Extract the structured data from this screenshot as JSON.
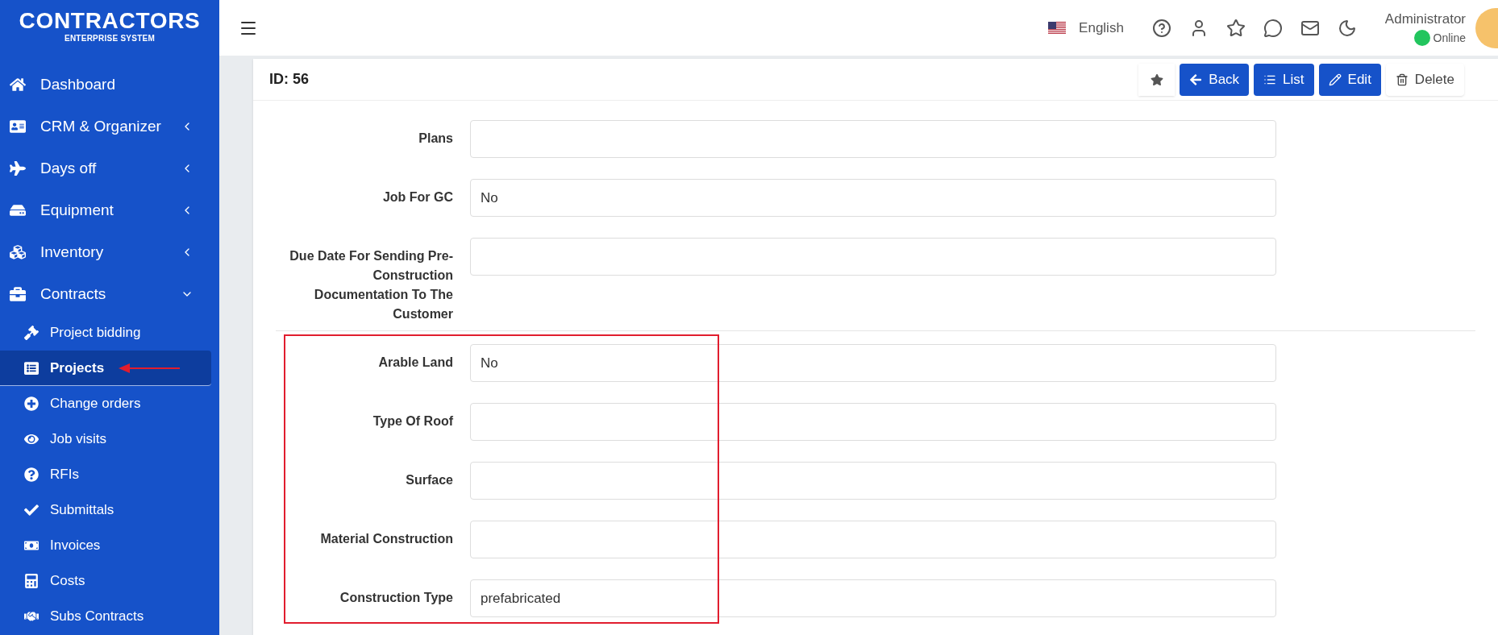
{
  "brand": {
    "name": "CONTRACTORS",
    "tagline": "ENTERPRISE SYSTEM"
  },
  "sidebar": {
    "items": [
      {
        "label": "Dashboard",
        "kind": "leaf"
      },
      {
        "label": "CRM & Organizer",
        "kind": "group",
        "expanded": false
      },
      {
        "label": "Days off",
        "kind": "group",
        "expanded": false
      },
      {
        "label": "Equipment",
        "kind": "group",
        "expanded": false
      },
      {
        "label": "Inventory",
        "kind": "group",
        "expanded": false
      },
      {
        "label": "Contracts",
        "kind": "group",
        "expanded": true,
        "children": [
          {
            "label": "Project bidding",
            "selected": false
          },
          {
            "label": "Projects",
            "selected": true
          },
          {
            "label": "Change orders",
            "selected": false
          },
          {
            "label": "Job visits",
            "selected": false
          },
          {
            "label": "RFIs",
            "selected": false
          },
          {
            "label": "Submittals",
            "selected": false
          },
          {
            "label": "Invoices",
            "selected": false
          },
          {
            "label": "Costs",
            "selected": false
          },
          {
            "label": "Subs Contracts",
            "selected": false
          }
        ]
      }
    ]
  },
  "header": {
    "language": "English",
    "user": {
      "name": "Administrator",
      "status": "Online",
      "color": "#22c55e"
    }
  },
  "record": {
    "title": "ID: 56",
    "buttons": [
      {
        "kind": "favorite"
      },
      {
        "kind": "primary",
        "label": "Back"
      },
      {
        "kind": "primary",
        "label": "List"
      },
      {
        "kind": "primary",
        "label": "Edit"
      },
      {
        "kind": "plain",
        "label": "Delete"
      }
    ],
    "sections": [
      {
        "highlighted": false,
        "fields": [
          {
            "label": "Plans"
          },
          {
            "label": "Job For GC",
            "value": "No"
          },
          {
            "label": "Due Date For Sending Pre-Construction Documentation To The Customer"
          }
        ]
      },
      {
        "highlighted": true,
        "fields": [
          {
            "label": "Arable Land",
            "value": "No"
          },
          {
            "label": "Type Of Roof"
          },
          {
            "label": "Surface"
          },
          {
            "label": "Material Construction"
          },
          {
            "label": "Construction Type",
            "value": "prefabricated"
          }
        ]
      }
    ]
  }
}
